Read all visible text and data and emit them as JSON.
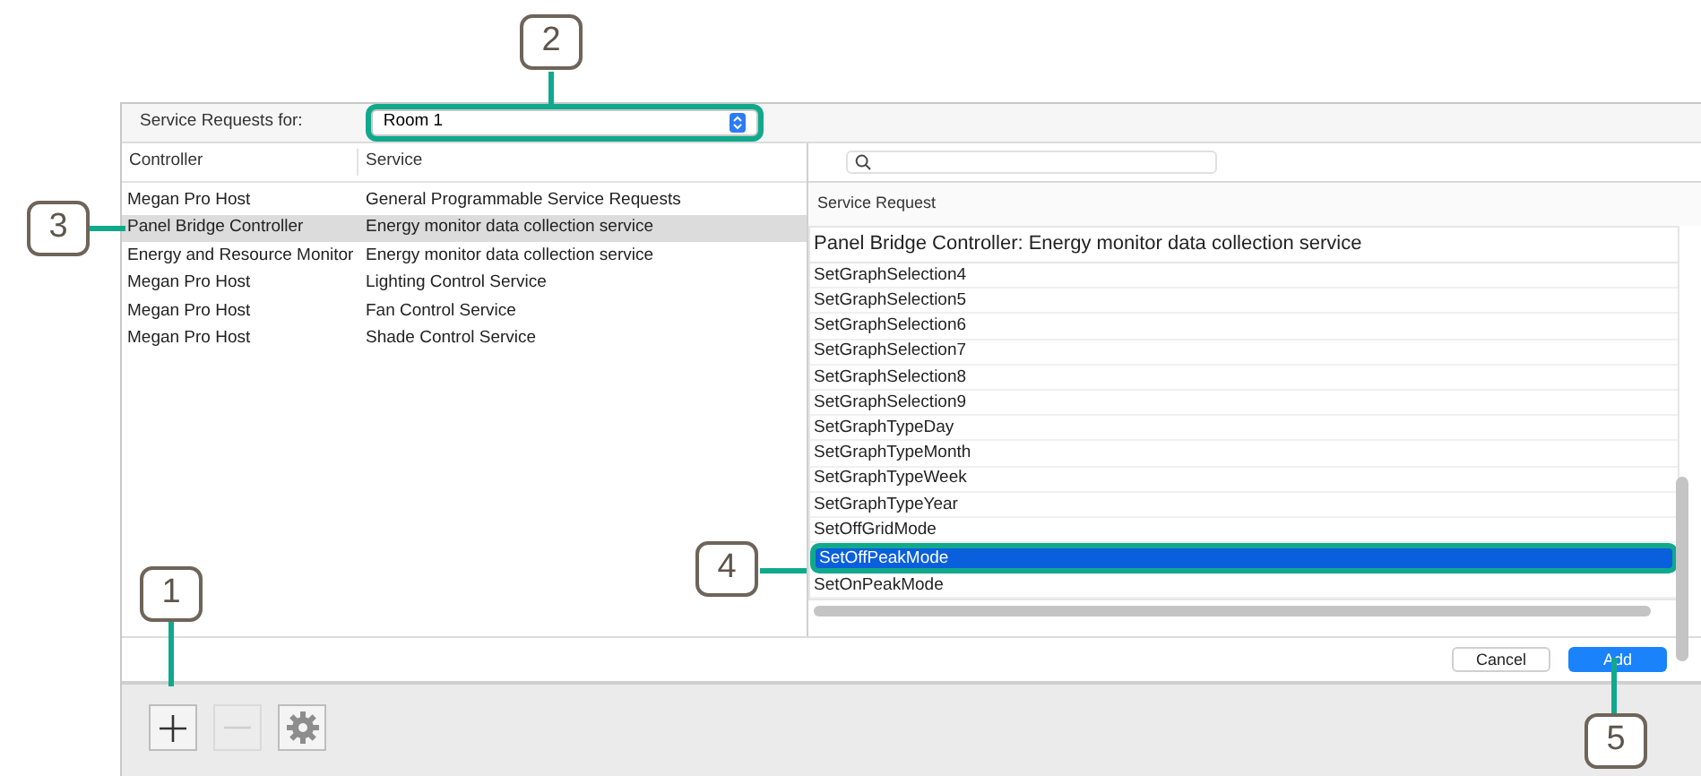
{
  "header": {
    "label": "Service Requests for:",
    "room": "Room 1"
  },
  "services_table": {
    "columns": [
      "Controller",
      "Service"
    ],
    "rows": [
      {
        "controller": "Megan Pro Host",
        "service": "General Programmable Service Requests",
        "selected": false
      },
      {
        "controller": "Panel Bridge Controller",
        "service": "Energy monitor data collection service",
        "selected": true
      },
      {
        "controller": "Energy and Resource Monitor",
        "service": "Energy monitor data collection service",
        "selected": false
      },
      {
        "controller": "Megan Pro Host",
        "service": "Lighting Control Service",
        "selected": false
      },
      {
        "controller": "Megan Pro Host",
        "service": "Fan Control Service",
        "selected": false
      },
      {
        "controller": "Megan Pro Host",
        "service": "Shade Control Service",
        "selected": false
      }
    ]
  },
  "request_panel": {
    "column": "Service Request",
    "title": "Panel Bridge Controller: Energy monitor data collection service",
    "items": [
      {
        "label": "SetGraphSelection4",
        "selected": false
      },
      {
        "label": "SetGraphSelection5",
        "selected": false
      },
      {
        "label": "SetGraphSelection6",
        "selected": false
      },
      {
        "label": "SetGraphSelection7",
        "selected": false
      },
      {
        "label": "SetGraphSelection8",
        "selected": false
      },
      {
        "label": "SetGraphSelection9",
        "selected": false
      },
      {
        "label": "SetGraphTypeDay",
        "selected": false
      },
      {
        "label": "SetGraphTypeMonth",
        "selected": false
      },
      {
        "label": "SetGraphTypeWeek",
        "selected": false
      },
      {
        "label": "SetGraphTypeYear",
        "selected": false
      },
      {
        "label": "SetOffGridMode",
        "selected": false
      },
      {
        "label": "SetOffPeakMode",
        "selected": true
      },
      {
        "label": "SetOnPeakMode",
        "selected": false
      }
    ]
  },
  "dialog_buttons": [
    "Cancel",
    "Add"
  ],
  "toolbar": [
    {
      "kind": "add",
      "disabled": false
    },
    {
      "kind": "remove",
      "disabled": true
    },
    {
      "kind": "settings",
      "disabled": false
    }
  ],
  "annotations": [
    "1",
    "2",
    "3",
    "4",
    "5"
  ]
}
